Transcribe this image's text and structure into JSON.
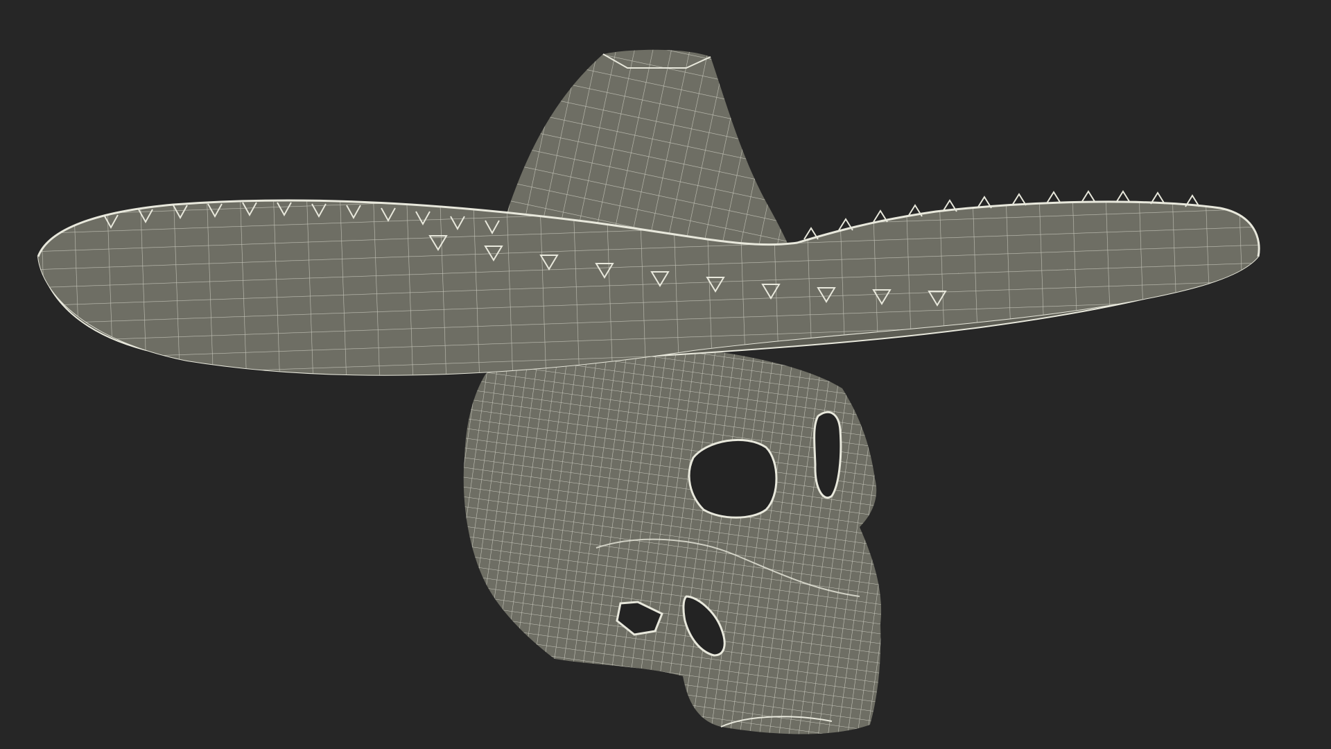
{
  "scene": {
    "background_color": "#262626",
    "surface_color": "#6e6e64",
    "surface_shadow_color": "#5e5e55",
    "wire_color": "#e8e8dc",
    "hole_color": "#232323",
    "objects": [
      {
        "name": "sombrero-hat",
        "render_style": "wireframe-on-shaded"
      },
      {
        "name": "skull",
        "render_style": "wireframe-on-shaded"
      }
    ]
  }
}
